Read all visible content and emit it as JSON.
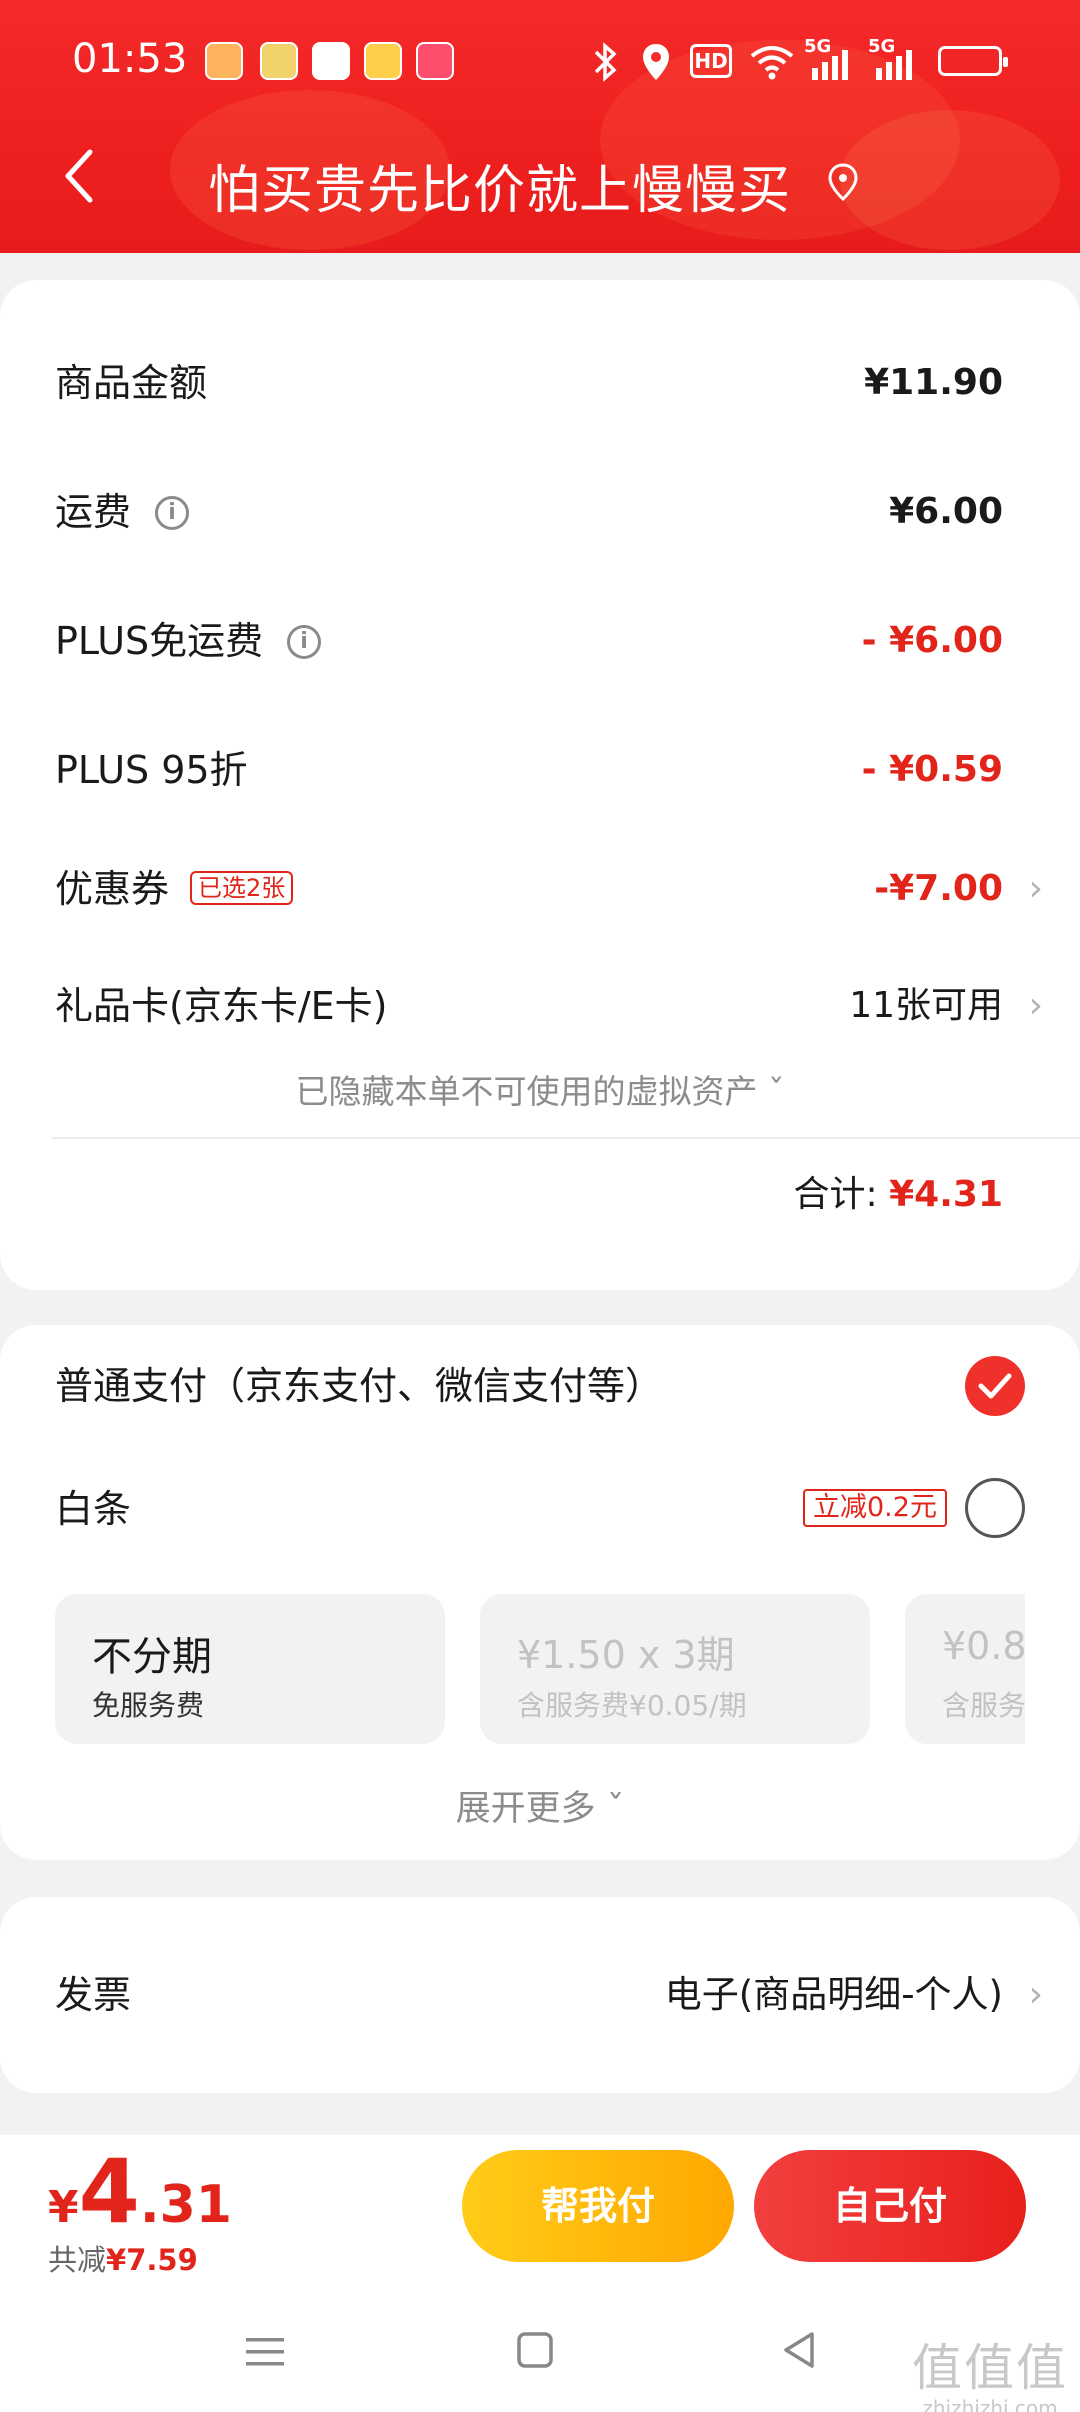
{
  "status_bar": {
    "time": "01:53",
    "network_labels": [
      "HD",
      "5G",
      "5G"
    ]
  },
  "nav": {
    "title": "怕买贵先比价就上慢慢买",
    "back_icon": "chevron-left-icon",
    "location_icon": "location-pin-icon"
  },
  "summary": {
    "rows": [
      {
        "label": "商品金额",
        "value": "¥11.90"
      },
      {
        "label": "运费",
        "value": "¥6.00"
      },
      {
        "label": "PLUS免运费",
        "value": "- ¥6.00"
      },
      {
        "label": "PLUS 95折",
        "value": "- ¥0.59"
      },
      {
        "label": "优惠券",
        "badge": "已选2张",
        "value": "-¥7.00"
      },
      {
        "label": "礼品卡(京东卡/E卡)",
        "value": "11张可用"
      }
    ],
    "hidden_assets": "已隐藏本单不可使用的虚拟资产",
    "total_label": "合计:",
    "total_value": "¥4.31"
  },
  "payment": {
    "normal_label": "普通支付（京东支付、微信支付等）",
    "baitiao_label": "白条",
    "baitiao_promo": "立减0.2元",
    "installments": [
      {
        "title": "不分期",
        "sub": "免服务费"
      },
      {
        "title": "¥1.50 x 3期",
        "sub": "含服务费¥0.05/期"
      },
      {
        "title": "¥0.8",
        "sub": "含服务"
      }
    ],
    "expand": "展开更多"
  },
  "invoice": {
    "label": "发票",
    "value": "电子(商品明细-个人)"
  },
  "bottom": {
    "currency": "¥",
    "price_int": "4",
    "price_dec": ".31",
    "saved_label": "共减",
    "saved_value": "¥7.59",
    "help_pay": "帮我付",
    "self_pay": "自己付"
  },
  "watermark": {
    "main": "值值值",
    "sub": "zhizhizhi.com"
  },
  "colors": {
    "accent_red": "#e1251b",
    "header_red": "#f52a2a",
    "help_btn_yellow": "#ffb80f"
  }
}
